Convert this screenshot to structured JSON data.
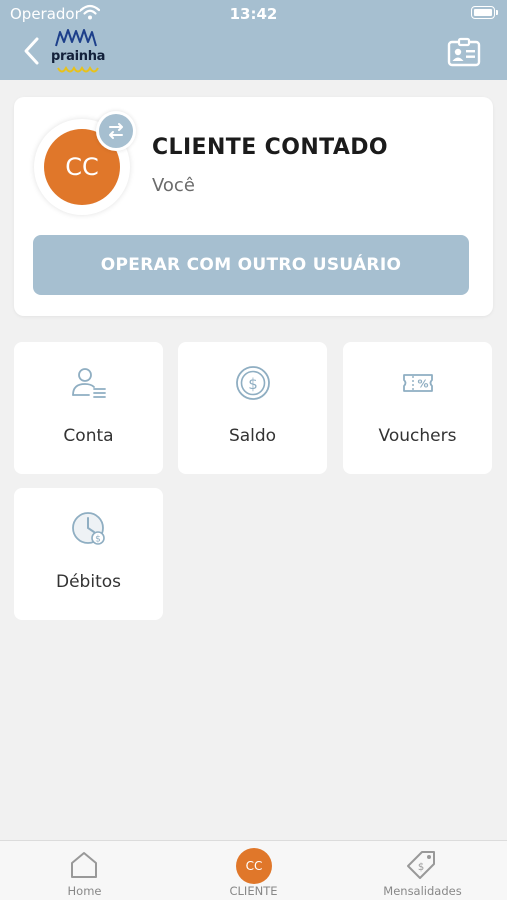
{
  "status_bar": {
    "carrier": "Operador",
    "time": "13:42"
  },
  "header": {
    "logo_text": "prainha",
    "icons": [
      "back-chevron-icon",
      "id-card-icon"
    ]
  },
  "profile": {
    "initials": "CC",
    "name": "CLIENTE CONTADO",
    "subtitle": "Você",
    "operate_button": "OPERAR COM OUTRO USUÁRIO"
  },
  "tiles": [
    {
      "label": "Conta",
      "icon": "user-list-icon"
    },
    {
      "label": "Saldo",
      "icon": "dollar-coin-icon"
    },
    {
      "label": "Vouchers",
      "icon": "voucher-ticket-icon"
    },
    {
      "label": "Débitos",
      "icon": "clock-debt-icon"
    }
  ],
  "tabbar": [
    {
      "label": "Home",
      "icon": "home-icon"
    },
    {
      "label": "CLIENTE",
      "avatar": "CC"
    },
    {
      "label": "Mensalidades",
      "icon": "price-tag-icon"
    }
  ],
  "colors": {
    "header": "#a6bfd0",
    "accent": "#e0772a",
    "icon_stroke": "#8faec2",
    "background": "#f1f1f1"
  }
}
